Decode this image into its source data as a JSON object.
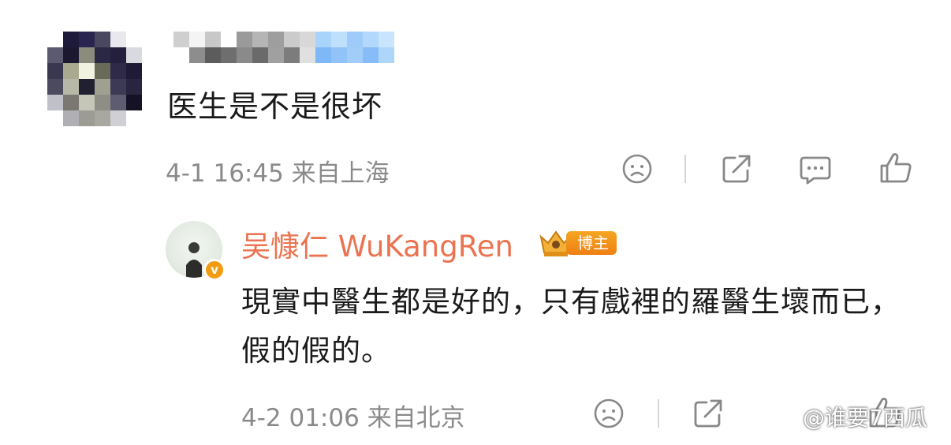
{
  "comment": {
    "text": "医生是不是很坏",
    "meta": "4-1 16:45 来自上海"
  },
  "reply": {
    "author": "吴慷仁 WuKangRen",
    "badge": "博主",
    "text": "現實中醫生都是好的，只有戲裡的羅醫生壞而已，假的假的。",
    "meta": "4-2 01:06 来自北京",
    "verified_mark": "v"
  },
  "watermark": "@谁要7西瓜",
  "actions": [
    "sad-face-icon",
    "share-icon",
    "comment-icon",
    "like-icon"
  ],
  "colors": {
    "accent": "#eb7350",
    "badge": "#f39c12",
    "meta": "#8a8a8a"
  }
}
